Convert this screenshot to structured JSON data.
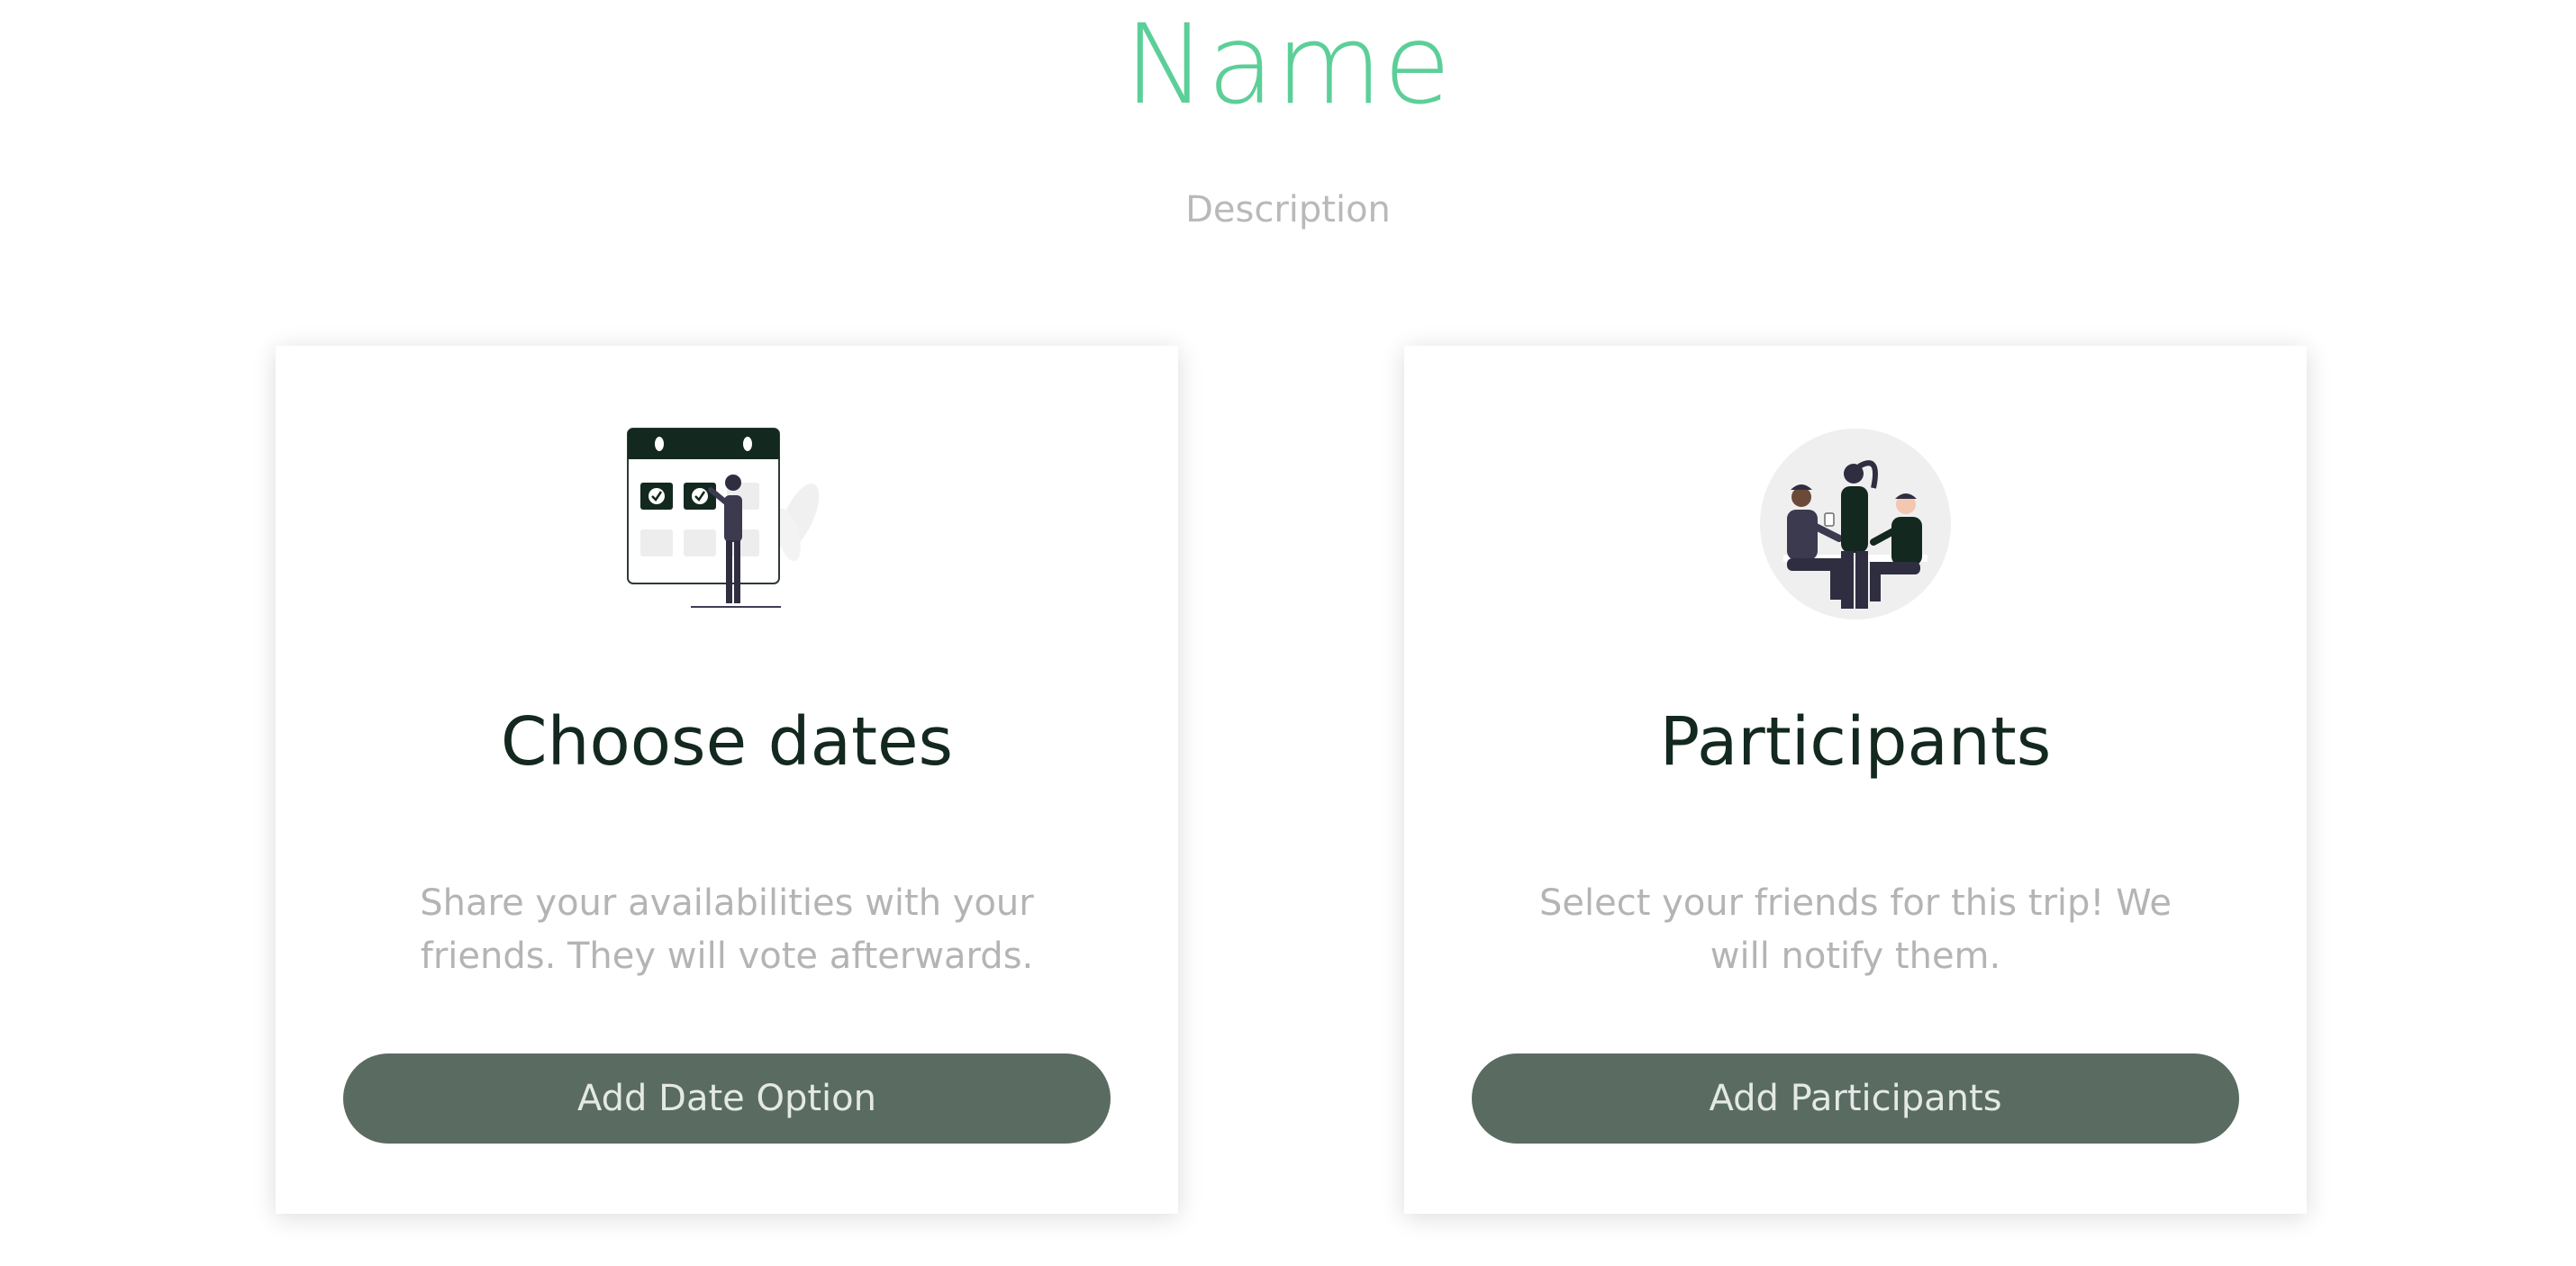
{
  "header": {
    "title": "Name",
    "description": "Description"
  },
  "cards": [
    {
      "icon": "calendar-illustration",
      "title": "Choose dates",
      "text": "Share your availabilities with your friends. They will vote afterwards.",
      "button_label": "Add Date Option"
    },
    {
      "icon": "people-meeting-illustration",
      "title": "Participants",
      "text": "Select your friends for this trip! We will notify them.",
      "button_label": "Add Participants"
    }
  ],
  "colors": {
    "accent": "#5ccf98",
    "dark_green": "#13281e",
    "button": "#5a6b62",
    "muted_text": "#b4b4b4"
  }
}
